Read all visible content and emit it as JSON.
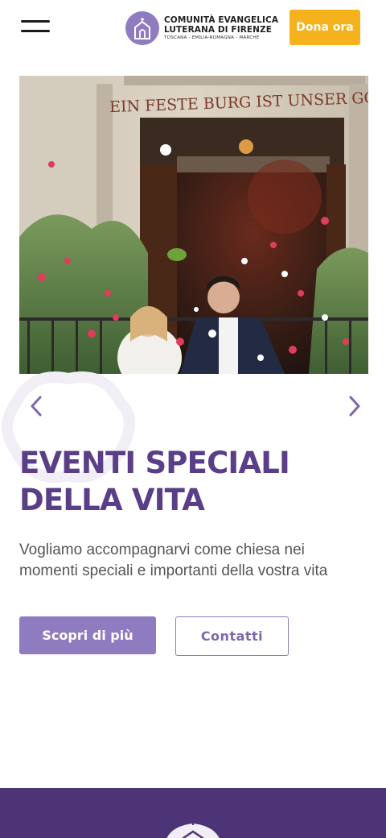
{
  "header": {
    "menu_icon": "hamburger-menu-icon",
    "logo": {
      "icon": "church-logo-icon",
      "line1": "COMUNITÀ EVANGELICA",
      "line2": "LUTERANA DI FIRENZE",
      "line3": "TOSCANA - EMILIA-ROMAGNA - MARCHE"
    },
    "donate_label": "Dona ora"
  },
  "hero": {
    "image_inscription": "EIN FESTE BURG IST UNSER GOTT",
    "prev_icon": "chevron-left-icon",
    "next_icon": "chevron-right-icon",
    "title_line1": "EVENTI SPECIALI",
    "title_line2": "DELLA VITA",
    "desc_line1": "Vogliamo accompagnarvi come chiesa nei",
    "desc_line2": "momenti speciali e importanti della vostra vita",
    "primary_cta": "Scopri di più",
    "secondary_cta": "Contatti"
  },
  "colors": {
    "brand_purple": "#5a3f88",
    "accent_lavender": "#8f7bc0",
    "donate_yellow": "#f6b21c",
    "footer_purple": "#4c3476"
  }
}
